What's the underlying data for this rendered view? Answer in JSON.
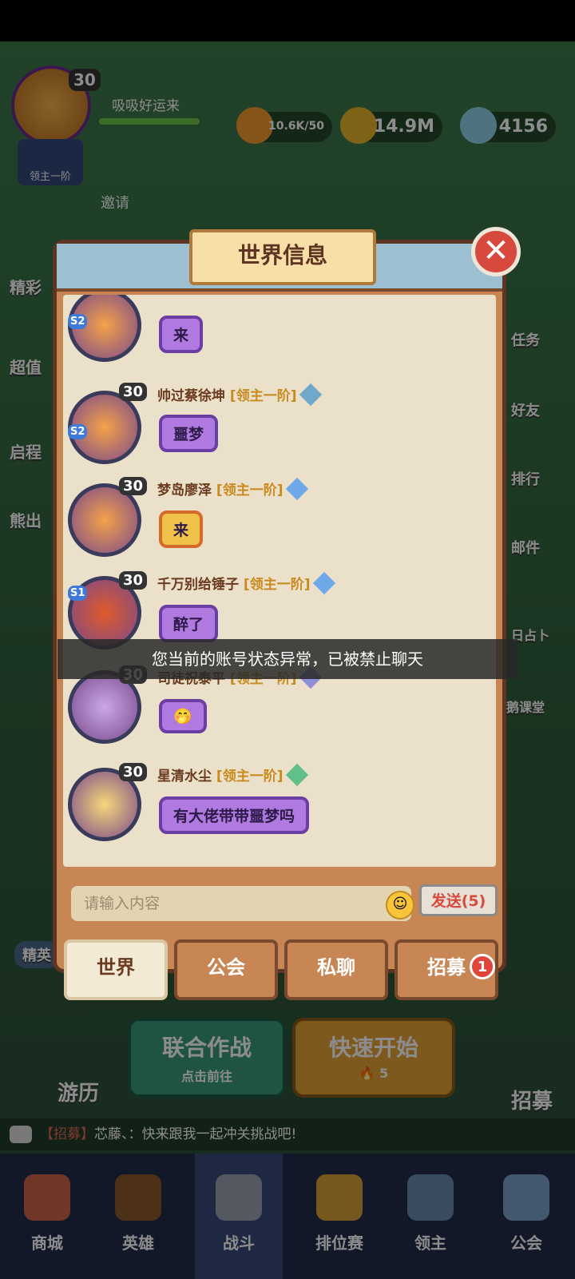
{
  "hud": {
    "level": "30",
    "player_name": "吸吸好运来",
    "rank_label": "领主一阶",
    "invite_label": "邀请",
    "energy": "10.6K/50",
    "gold": "14.9M",
    "gems": "4156"
  },
  "left_menu": [
    "精彩",
    "超值",
    "启程",
    "熊出"
  ],
  "right_menu": [
    "任务",
    "好友",
    "排行",
    "邮件",
    "日占卜",
    "鹅课堂"
  ],
  "modal": {
    "title": "世界信息",
    "close_label": "✕"
  },
  "messages": [
    {
      "level": "",
      "season": "S2",
      "name": "",
      "rank": "",
      "text": "来",
      "gold": false,
      "avatar_color": "#f5a24a",
      "gem_color": "#8f8fd8"
    },
    {
      "level": "30",
      "season": "S2",
      "name": "帅过蔡徐坤",
      "rank": "[领主一阶]",
      "text": "噩梦",
      "gold": false,
      "avatar_color": "#f5a24a",
      "gem_color": "#6fa8c8"
    },
    {
      "level": "30",
      "season": "",
      "name": "梦岛廖泽",
      "rank": "[领主一阶]",
      "text": "来",
      "gold": true,
      "avatar_color": "#f5a24a",
      "gem_color": "#6fa8e8"
    },
    {
      "level": "30",
      "season": "S1",
      "name": "千万别给锤子",
      "rank": "[领主一阶]",
      "text": "醉了",
      "gold": false,
      "avatar_color": "#e05a2a",
      "gem_color": "#6fa8e8"
    },
    {
      "level": "30",
      "season": "",
      "name": "司徒祝泰平",
      "rank": "[领主一阶]",
      "text": "🤭",
      "gold": false,
      "avatar_color": "#c9a8e8",
      "gem_color": "#8f8fd8"
    },
    {
      "level": "30",
      "season": "",
      "name": "星清水尘",
      "rank": "[领主一阶]",
      "text": "有大佬带带噩梦吗",
      "gold": false,
      "avatar_color": "#f7d77a",
      "gem_color": "#5fc08a"
    }
  ],
  "toast": "您当前的账号状态异常，已被禁止聊天",
  "input": {
    "placeholder": "请输入内容",
    "send_label": "发送(5)"
  },
  "tabs": [
    "世界",
    "公会",
    "私聊",
    "招募"
  ],
  "recruit_badge": "1",
  "buttons": {
    "coop_title": "联合作战",
    "coop_sub": "点击前往",
    "quick_title": "快速开始",
    "quick_count": "5",
    "travel": "游历",
    "recruit": "招募",
    "elite": "精英"
  },
  "ticker": {
    "tag": "【招募】",
    "text": "芯藤、：快来跟我一起冲关挑战吧!"
  },
  "bottom_nav": [
    "商城",
    "英雄",
    "战斗",
    "排位赛",
    "领主",
    "公会"
  ]
}
